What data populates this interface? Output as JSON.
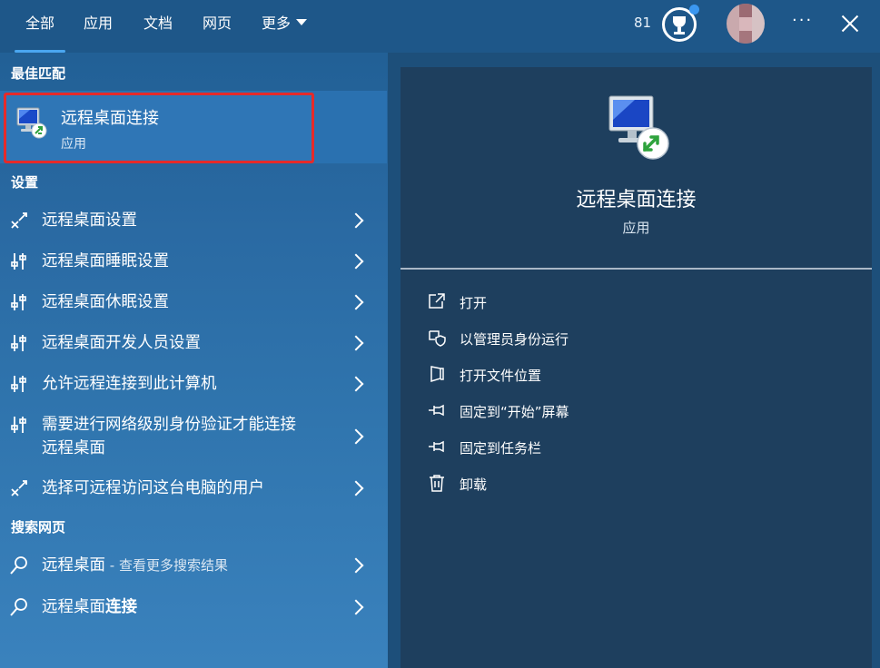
{
  "tabs": [
    {
      "label": "全部",
      "active": true
    },
    {
      "label": "应用"
    },
    {
      "label": "文档"
    },
    {
      "label": "网页"
    },
    {
      "label": "更多"
    }
  ],
  "header": {
    "points": "81",
    "reward_icon": "trophy-icon",
    "more_icon": "more-icon",
    "close_icon": "close-icon"
  },
  "best_match": {
    "heading": "最佳匹配",
    "title": "远程桌面连接",
    "subtitle": "应用",
    "icon": "remote-desktop-icon"
  },
  "settings": {
    "heading": "设置",
    "items": [
      {
        "label": "远程桌面设置",
        "icon": "remote-desktop-settings-icon"
      },
      {
        "label": "远程桌面睡眠设置",
        "icon": "settings-sliders-icon"
      },
      {
        "label": "远程桌面休眠设置",
        "icon": "settings-sliders-icon"
      },
      {
        "label": "远程桌面开发人员设置",
        "icon": "settings-sliders-icon"
      },
      {
        "label": "允许远程连接到此计算机",
        "icon": "settings-sliders-icon"
      },
      {
        "label": "需要进行网络级别身份验证才能连接",
        "label2": "远程桌面",
        "icon": "settings-sliders-icon"
      },
      {
        "label": "选择可远程访问这台电脑的用户",
        "icon": "remote-desktop-settings-icon"
      }
    ]
  },
  "web": {
    "heading": "搜索网页",
    "items": [
      {
        "label": "远程桌面",
        "hint": " - 查看更多搜索结果",
        "icon": "search-icon"
      },
      {
        "label": "远程桌面",
        "bold": "连接",
        "icon": "search-icon"
      }
    ]
  },
  "detail": {
    "title": "远程桌面连接",
    "subtitle": "应用",
    "actions": [
      {
        "label": "打开",
        "icon": "open-icon"
      },
      {
        "label": "以管理员身份运行",
        "icon": "shield-icon"
      },
      {
        "label": "打开文件位置",
        "icon": "folder-icon"
      },
      {
        "label": "固定到“开始”屏幕",
        "icon": "pin-icon"
      },
      {
        "label": "固定到任务栏",
        "icon": "pin-icon"
      },
      {
        "label": "卸载",
        "icon": "trash-icon"
      }
    ]
  }
}
